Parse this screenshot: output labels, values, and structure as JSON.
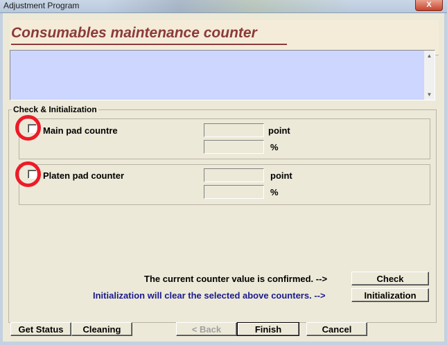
{
  "window": {
    "title": "Adjustment Program",
    "close_label": "X"
  },
  "header": {
    "title": "Consumables maintenance counter"
  },
  "group": {
    "title": "Check & Initialization",
    "items": [
      {
        "label": "Main pad countre",
        "unit_point": "point",
        "unit_percent": "%"
      },
      {
        "label": "Platen pad counter",
        "unit_point": "point",
        "unit_percent": "%"
      }
    ]
  },
  "messages": {
    "check": "The current counter value is confirmed. -->",
    "init": "Initialization will clear the selected above counters. -->"
  },
  "buttons": {
    "check": "Check",
    "initialization": "Initialization",
    "get_status": "Get Status",
    "cleaning": "Cleaning",
    "back": "< Back",
    "finish": "Finish",
    "cancel": "Cancel"
  },
  "colors": {
    "accent": "#8b3a3a",
    "info_bg": "#ccd6ff",
    "highlight": "#ee1a27",
    "message_blue": "#1a1a8c"
  }
}
